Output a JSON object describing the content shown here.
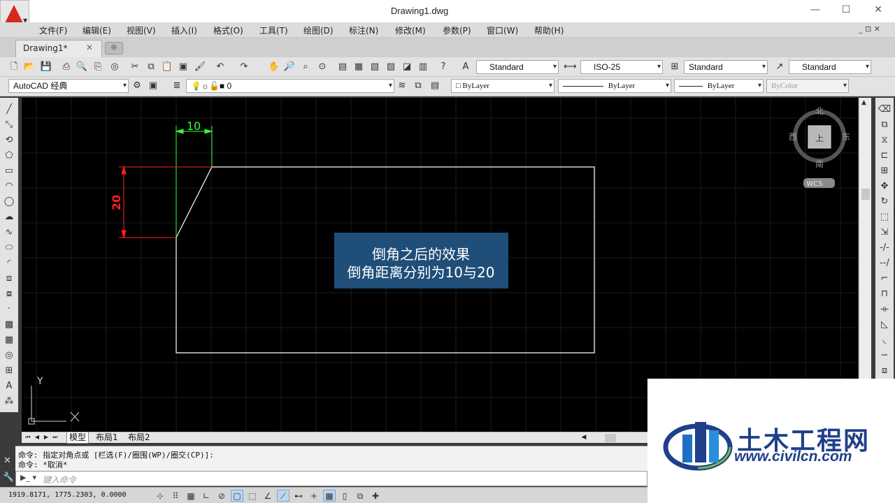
{
  "window": {
    "title": "Drawing1.dwg",
    "minimize": "—",
    "maximize": "☐",
    "close": "✕"
  },
  "menu": [
    {
      "label": "文件(F)"
    },
    {
      "label": "编辑(E)"
    },
    {
      "label": "视图(V)"
    },
    {
      "label": "插入(I)"
    },
    {
      "label": "格式(O)"
    },
    {
      "label": "工具(T)"
    },
    {
      "label": "绘图(D)"
    },
    {
      "label": "标注(N)"
    },
    {
      "label": "修改(M)"
    },
    {
      "label": "参数(P)"
    },
    {
      "label": "窗口(W)"
    },
    {
      "label": "帮助(H)"
    }
  ],
  "menu_window_controls": "_ ⊡ ✕",
  "tabs": {
    "document": "Drawing1*",
    "close": "✕"
  },
  "styles": {
    "text_style": "Standard",
    "dim_style": "ISO-25",
    "table_style": "Standard",
    "multileader_style": "Standard"
  },
  "workspace": "AutoCAD 经典",
  "layer": {
    "name": "0"
  },
  "properties": {
    "color": "ByLayer",
    "linetype": "ByLayer",
    "lineweight": "ByLayer",
    "plotstyle": "ByColor"
  },
  "drawing": {
    "dim_top": "10",
    "dim_left": "20",
    "note_line1": "倒角之后的效果",
    "note_line2": "倒角距离分别为10与20"
  },
  "viewcube": {
    "north": "北",
    "south": "南",
    "west": "西",
    "east": "东",
    "top": "上",
    "wcs": "WCS"
  },
  "ucs": {
    "x": "X",
    "y": "Y"
  },
  "layout_tabs": [
    {
      "label": "模型",
      "active": true
    },
    {
      "label": "布局1",
      "active": false
    },
    {
      "label": "布局2",
      "active": false
    }
  ],
  "command": {
    "line1": "命令: 指定对角点或 [栏选(F)/圈围(WP)/圈交(CP)]:",
    "line2": "命令: *取消*",
    "placeholder": "键入命令"
  },
  "status": {
    "coords": "1919.8171, 1775.2303, 0.0000"
  },
  "watermark": {
    "name": "土木工程网",
    "url": "www.civilcn.com"
  },
  "colors": {
    "canvas": "#000000",
    "dimension_green": "#33ff33",
    "dimension_red": "#ff2020",
    "note_bg": "#1f4e79",
    "brand_blue": "#1f3f8a"
  }
}
